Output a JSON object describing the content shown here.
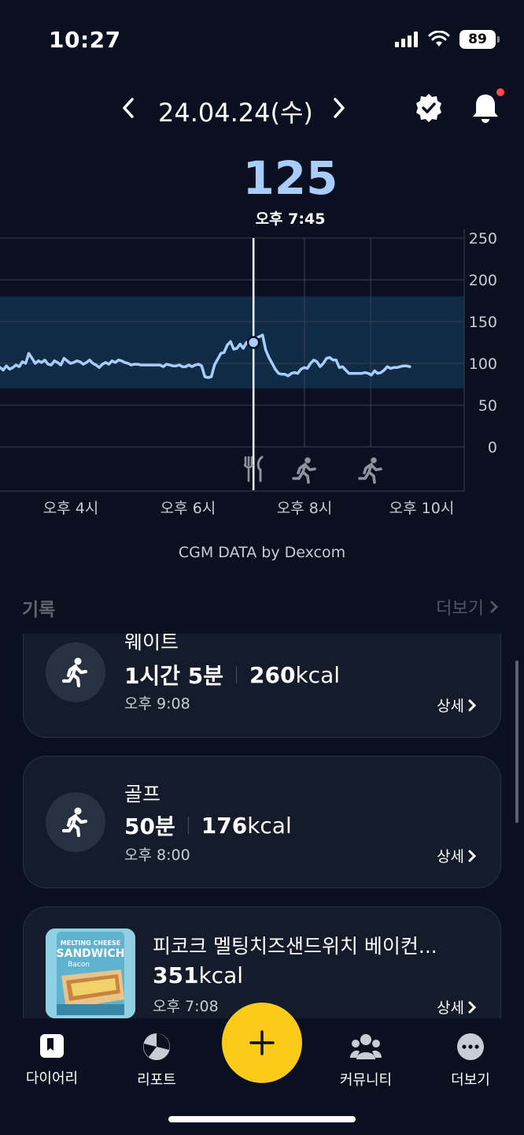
{
  "status_bar": {
    "time": "10:27",
    "battery": "89"
  },
  "header": {
    "date": "24.04.24(수)"
  },
  "glucose": {
    "value": "125",
    "time": "오후 7:45"
  },
  "chart_data": {
    "type": "line",
    "x_tick_labels": [
      "오후 4시",
      "오후 6시",
      "오후 8시",
      "오후 10시"
    ],
    "y_tick_labels": [
      "250",
      "200",
      "150",
      "100",
      "50",
      "0"
    ],
    "ylim": [
      0,
      250
    ],
    "target_range": [
      70,
      180
    ],
    "x": [
      0,
      3,
      6,
      9,
      12,
      15,
      18,
      21,
      24,
      27,
      30,
      33,
      36,
      39,
      42,
      45,
      48,
      51,
      54,
      57,
      60,
      63,
      66,
      69,
      72,
      75,
      78,
      81,
      84,
      87,
      90,
      93,
      96,
      99,
      102,
      105,
      108,
      111,
      114,
      117,
      120,
      123,
      126,
      129,
      132,
      135,
      138,
      141,
      144,
      147,
      150,
      153,
      156,
      159,
      162,
      165,
      168,
      171,
      174,
      177,
      180,
      183,
      186,
      189,
      192,
      195,
      198,
      201,
      204,
      207,
      210,
      213,
      216,
      219,
      222,
      225,
      228,
      231,
      234,
      237,
      240,
      243,
      246,
      249,
      252,
      255,
      258,
      261,
      264,
      267,
      270,
      273,
      276,
      279,
      282,
      285,
      288,
      291,
      294,
      297,
      300,
      303,
      306,
      309,
      312,
      315,
      318,
      321,
      324,
      327,
      330,
      333,
      336,
      339,
      342,
      345,
      348,
      351,
      354,
      357,
      360,
      363,
      366,
      369,
      372,
      375,
      378,
      381,
      384,
      387,
      390,
      393,
      396,
      399,
      402,
      405,
      408,
      411,
      414,
      417,
      420,
      423,
      426,
      429,
      432,
      435
    ],
    "values": [
      95,
      92,
      97,
      93,
      95,
      98,
      96,
      102,
      100,
      112,
      106,
      100,
      103,
      101,
      104,
      99,
      98,
      103,
      101,
      98,
      106,
      103,
      100,
      101,
      103,
      102,
      99,
      101,
      104,
      100,
      98,
      95,
      99,
      101,
      99,
      103,
      101,
      104,
      103,
      101,
      100,
      98,
      99,
      99,
      98,
      98,
      98,
      98,
      98,
      98,
      98,
      96,
      99,
      98,
      97,
      97,
      98,
      96,
      96,
      98,
      96,
      98,
      99,
      97,
      84,
      83,
      84,
      98,
      105,
      112,
      113,
      122,
      126,
      117,
      118,
      123,
      118,
      125,
      122,
      125,
      130,
      132,
      134,
      116,
      107,
      100,
      93,
      88,
      87,
      87,
      85,
      88,
      89,
      88,
      93,
      95,
      94,
      100,
      104,
      102,
      96,
      100,
      106,
      107,
      104,
      104,
      95,
      96,
      92,
      88,
      88,
      88,
      88,
      88,
      89,
      88,
      86,
      91,
      88,
      89,
      92,
      96,
      94,
      95,
      95,
      96,
      97,
      97,
      96
    ],
    "selected_point": {
      "x": 225,
      "value": 125
    },
    "event_markers": [
      "meal",
      "exercise",
      "exercise"
    ]
  },
  "credit": "CGM DATA by Dexcom",
  "records": {
    "title": "기록",
    "more": "더보기",
    "detail_label": "상세",
    "items": [
      {
        "name": "웨이트",
        "duration": "1시간 5분",
        "kcal_value": "260",
        "kcal_unit": "kcal",
        "time": "오후 9:08"
      },
      {
        "name": "골프",
        "duration": "50분",
        "kcal_value": "176",
        "kcal_unit": "kcal",
        "time": "오후 8:00"
      },
      {
        "name": "피코크 멜팅치즈샌드위치 베이컨...",
        "kcal_value": "351",
        "kcal_unit": "kcal",
        "time": "오후 7:08",
        "thumb_text_1": "MELTING CHEESE",
        "thumb_text_2": "SANDWICH",
        "thumb_text_3": "Bacon"
      }
    ]
  },
  "tabbar": {
    "diary": "다이어리",
    "report": "리포트",
    "community": "커뮤니티",
    "more": "더보기"
  },
  "colors": {
    "accent": "#fccb1a",
    "glucose_line": "#a9cdfb",
    "range_band": "#0f2b45"
  }
}
